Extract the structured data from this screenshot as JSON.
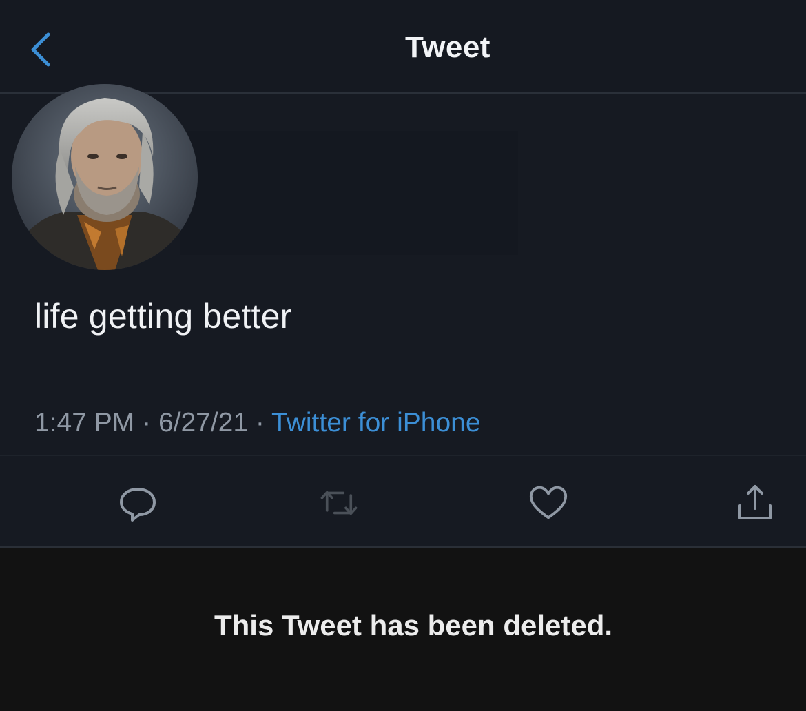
{
  "header": {
    "back_icon": "chevron-left-icon",
    "title": "Tweet"
  },
  "tweet": {
    "avatar_icon": "avatar",
    "text": "life getting better",
    "time": "1:47 PM",
    "separator": "·",
    "date": "6/27/21",
    "source": "Twitter for iPhone"
  },
  "actions": {
    "reply_icon": "reply-icon",
    "retweet_icon": "retweet-icon",
    "like_icon": "heart-icon",
    "share_icon": "share-icon"
  },
  "banner": {
    "text": "This Tweet has been deleted."
  },
  "colors": {
    "background": "#161a22",
    "accent": "#3c8fd6",
    "muted": "#8f98a4",
    "banner_bg": "#121212"
  }
}
